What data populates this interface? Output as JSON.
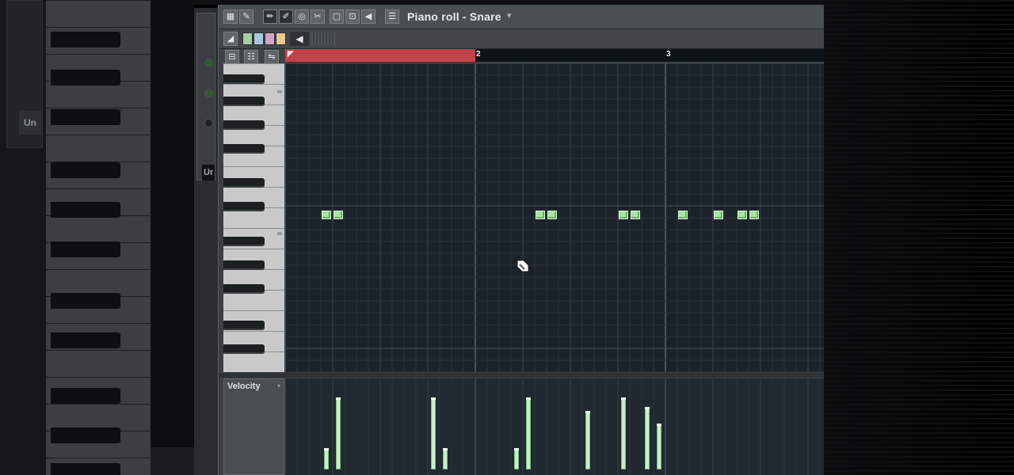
{
  "window": {
    "title": "Piano roll - Snare",
    "title_caret": "▾"
  },
  "side_panel": {
    "button_label": "Ur"
  },
  "bg_panel": {
    "button_label": "Un"
  },
  "toolbar_icons": [
    "piano-icon",
    "wrench-icon",
    "pencil-icon",
    "brush-icon",
    "mute-icon",
    "slice-icon",
    "select-icon",
    "zoom-icon",
    "speaker-icon",
    "list-icon"
  ],
  "swatches": [
    "#a7cfa4",
    "#a8c8dc",
    "#cfa6c9",
    "#e8c98e"
  ],
  "ruler": {
    "markers": [
      "2",
      "3"
    ]
  },
  "velocity": {
    "label": "Velocity",
    "arrow": "▾"
  },
  "notes": [
    {
      "bar": 1,
      "step": 3.0,
      "row": 14
    },
    {
      "bar": 1,
      "step": 4.0,
      "row": 14
    },
    {
      "bar": 2,
      "step": 5.0,
      "row": 14
    },
    {
      "bar": 2,
      "step": 6.0,
      "row": 14
    },
    {
      "bar": 2,
      "step": 12.0,
      "row": 14
    },
    {
      "bar": 2,
      "step": 13.0,
      "row": 14
    },
    {
      "bar": 3,
      "step": 1.0,
      "row": 14
    },
    {
      "bar": 3,
      "step": 4.0,
      "row": 14
    },
    {
      "bar": 3,
      "step": 6.0,
      "row": 14
    },
    {
      "bar": 3,
      "step": 7.0,
      "row": 14
    }
  ],
  "velocities": [
    {
      "pos": 3.0,
      "level": 0.21
    },
    {
      "pos": 4.0,
      "level": 0.77
    },
    {
      "pos": 12.0,
      "level": 0.77
    },
    {
      "pos": 13.0,
      "level": 0.21
    },
    {
      "pos": 19.0,
      "level": 0.21
    },
    {
      "pos": 20.0,
      "level": 0.77
    },
    {
      "pos": 25.0,
      "level": 0.62
    },
    {
      "pos": 28.0,
      "level": 0.77
    },
    {
      "pos": 30.0,
      "level": 0.67
    },
    {
      "pos": 31.0,
      "level": 0.48
    }
  ]
}
